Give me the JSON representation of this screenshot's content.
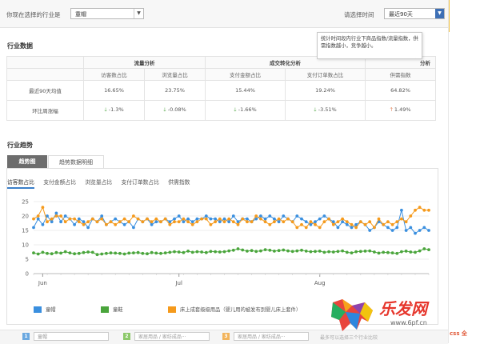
{
  "header": {
    "industry_label": "你现在选择的行业是",
    "industry_value": "童帽",
    "time_label": "请选择时间",
    "time_value": "最近90天"
  },
  "industry_data": {
    "title": "行业数据",
    "group_headers": [
      "流量分析",
      "成交转化分析",
      "分析"
    ],
    "col_headers": [
      "访客数占比",
      "浏览量占比",
      "支付金额占比",
      "支付订单数占比",
      "供需指数"
    ],
    "rows": [
      {
        "label": "最近90天均值",
        "values": [
          "16.65%",
          "23.75%",
          "15.44%",
          "19.24%",
          "64.82%"
        ]
      },
      {
        "label": "环比周涨幅",
        "values": [
          "-1.3%",
          "-0.08%",
          "-1.66%",
          "-3.51%",
          "1.49%"
        ],
        "dirs": [
          "down",
          "down",
          "down",
          "down",
          "up"
        ]
      }
    ],
    "tooltip": "统计时间段内行业下商品指数/流量指数，供需指数越小，竞争越小。"
  },
  "trend": {
    "title": "行业趋势",
    "tabs": [
      "趋势图",
      "趋势数据明细"
    ],
    "metric_tabs": [
      "访客数占比",
      "支付金额占比",
      "浏览量占比",
      "支付订单数占比",
      "供需指数"
    ],
    "legend": [
      "童帽",
      "童鞋",
      "床上成套级级用品（婴儿用的被发布到婴儿床上套件）"
    ]
  },
  "bottom": {
    "selects": [
      "童帽",
      "家居用品 / 家纺成品···",
      "家居用品 / 家纺成品···"
    ],
    "nums": [
      "1",
      "2",
      "3"
    ],
    "note": "最多可以选择三个行业比较"
  },
  "watermark": {
    "brand": "乐发网",
    "url": "www.6pf.cn",
    "corner": "css 全"
  },
  "colors": {
    "blue": "#3a8fdf",
    "green": "#4aa53c",
    "orange": "#f59a1c"
  },
  "chart_data": {
    "type": "line",
    "title": "",
    "xlabel": "",
    "ylabel": "",
    "ylim": [
      0,
      25
    ],
    "yticks": [
      0,
      5,
      10,
      15,
      20,
      25
    ],
    "x_month_labels": [
      "Jun",
      "Jul",
      "Aug"
    ],
    "x_month_label_index": [
      2,
      32,
      63
    ],
    "x_count": 88,
    "grid": true,
    "legend_position": "bottom-left",
    "series": [
      {
        "name": "童帽",
        "color": "#3a8fdf",
        "values": [
          16,
          19,
          17,
          20,
          18,
          21,
          18,
          20,
          19,
          17,
          19,
          18,
          16,
          19,
          18,
          20,
          17,
          18,
          19,
          18,
          17,
          18,
          16,
          19,
          18,
          19,
          17,
          18,
          18,
          19,
          18,
          19,
          20,
          18,
          19,
          18,
          19,
          19,
          20,
          19,
          19,
          18,
          19,
          18,
          20,
          18,
          19,
          19,
          18,
          19,
          20,
          19,
          20,
          19,
          18,
          20,
          19,
          18,
          20,
          19,
          18,
          17,
          18,
          19,
          20,
          19,
          18,
          16,
          18,
          17,
          16,
          17,
          18,
          17,
          15,
          16,
          18,
          17,
          16,
          15,
          16,
          22,
          15,
          16,
          14,
          15,
          16,
          15
        ]
      },
      {
        "name": "童鞋",
        "color": "#4aa53c",
        "values": [
          7.2,
          6.8,
          7.4,
          7.0,
          6.9,
          7.3,
          7.1,
          7.6,
          7.2,
          6.9,
          7.0,
          7.3,
          7.5,
          7.4,
          6.6,
          6.8,
          7.0,
          7.2,
          7.1,
          7.0,
          6.8,
          7.1,
          7.2,
          7.3,
          7.0,
          6.9,
          7.3,
          7.1,
          7.0,
          7.2,
          7.4,
          7.6,
          7.5,
          7.3,
          7.8,
          7.4,
          7.6,
          7.5,
          7.3,
          7.7,
          7.6,
          7.5,
          7.6,
          7.9,
          8.1,
          8.6,
          8.2,
          7.8,
          8.0,
          7.7,
          7.9,
          8.3,
          8.1,
          7.8,
          8.0,
          8.2,
          7.9,
          7.7,
          7.9,
          8.1,
          7.8,
          7.6,
          7.7,
          7.8,
          7.4,
          7.6,
          7.5,
          7.7,
          7.9,
          7.4,
          7.2,
          7.6,
          7.7,
          7.8,
          7.9,
          7.5,
          7.1,
          7.4,
          7.3,
          7.2,
          7.0,
          7.6,
          7.8,
          7.5,
          7.4,
          7.9,
          8.6,
          8.3
        ]
      },
      {
        "name": "床上成套级级用品（婴儿用的被发布到婴儿床上套件）",
        "color": "#f59a1c",
        "values": [
          19,
          20,
          23,
          18,
          19,
          20,
          20,
          18,
          19,
          19,
          18,
          17,
          18,
          19,
          18,
          19,
          17,
          18,
          17,
          18,
          19,
          18,
          20,
          19,
          18,
          19,
          18,
          19,
          18,
          19,
          17,
          18,
          18,
          19,
          18,
          17,
          18,
          19,
          19,
          17,
          18,
          19,
          18,
          19,
          18,
          17,
          19,
          18,
          18,
          20,
          19,
          18,
          17,
          18,
          19,
          18,
          19,
          18,
          16,
          17,
          16,
          18,
          17,
          16,
          18,
          19,
          17,
          18,
          19,
          18,
          17,
          16,
          18,
          17,
          18,
          16,
          19,
          17,
          18,
          17,
          18,
          19,
          18,
          20,
          22,
          23,
          22,
          22
        ]
      }
    ]
  }
}
